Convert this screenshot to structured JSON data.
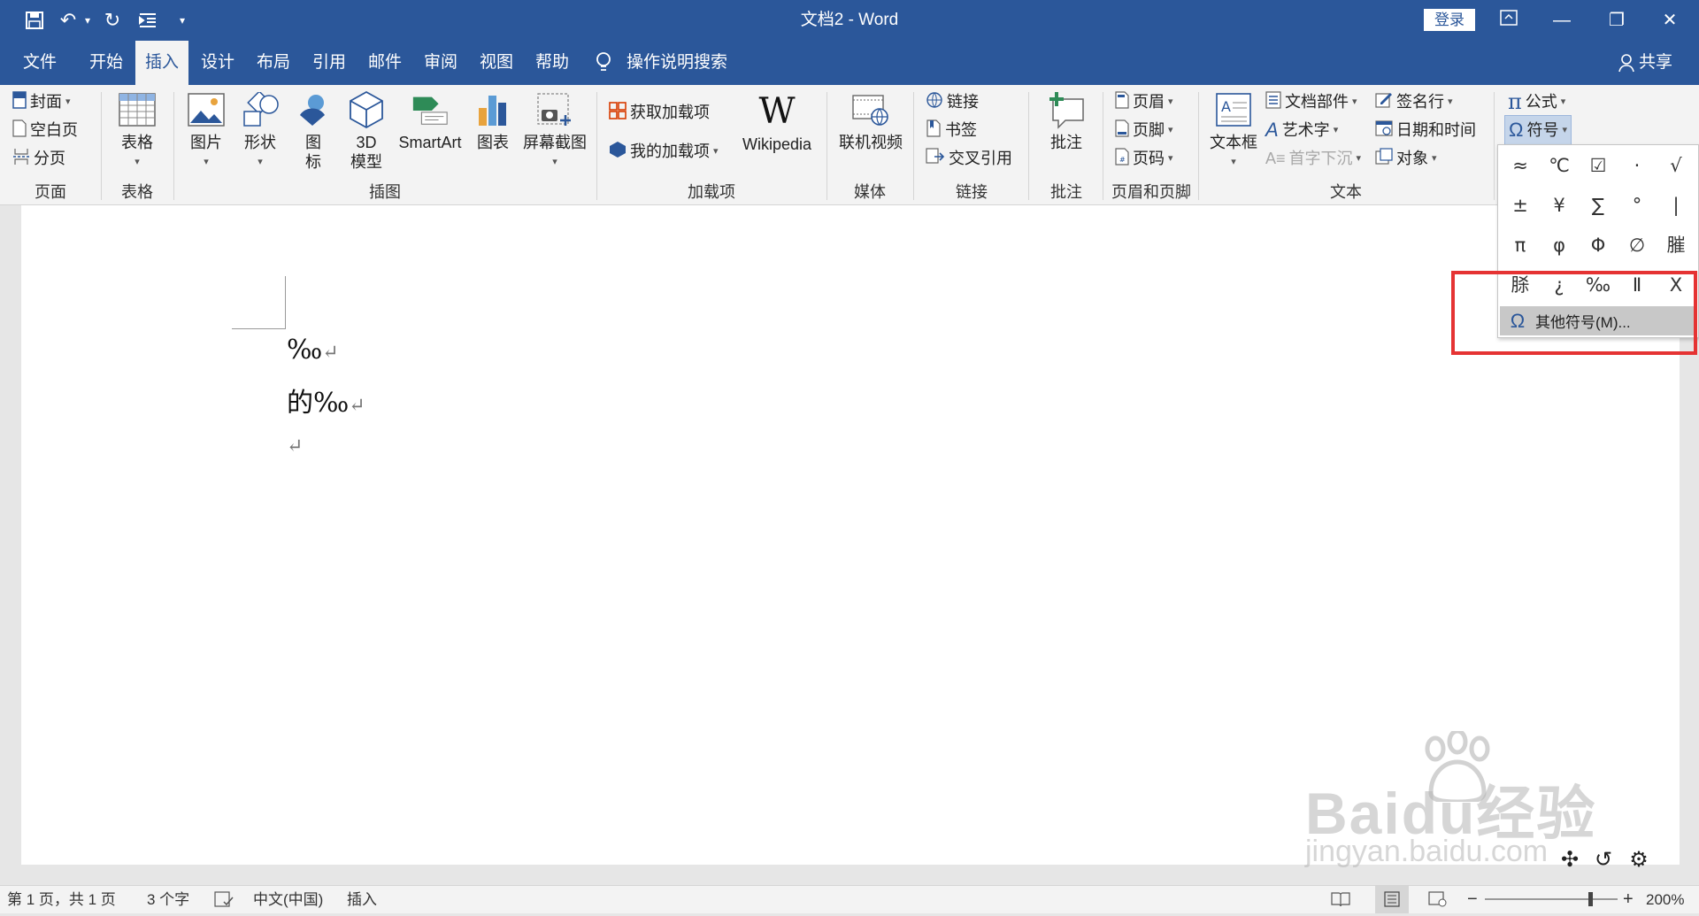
{
  "window": {
    "title": "文档2  -  Word",
    "login_label": "登录"
  },
  "quick_access": {
    "icons": [
      "save-icon",
      "undo-icon",
      "undo-dropdown-icon",
      "redo-icon",
      "outline-icon",
      "customize-qat-icon"
    ]
  },
  "tabs": [
    {
      "label": "文件"
    },
    {
      "label": "开始"
    },
    {
      "label": "插入"
    },
    {
      "label": "设计"
    },
    {
      "label": "布局"
    },
    {
      "label": "引用"
    },
    {
      "label": "邮件"
    },
    {
      "label": "审阅"
    },
    {
      "label": "视图"
    },
    {
      "label": "帮助"
    }
  ],
  "tell_me": "操作说明搜索",
  "share": "共享",
  "ribbon": {
    "pages": {
      "cover": "封面",
      "blank": "空白页",
      "break": "分页",
      "group": "页面"
    },
    "tables": {
      "table": "表格",
      "group": "表格"
    },
    "illustrations": {
      "picture": "图片",
      "shapes": "形状",
      "icons_1": "图",
      "icons_2": "标",
      "model_1": "3D",
      "model_2": "模型",
      "smartart": "SmartArt",
      "chart": "图表",
      "screenshot": "屏幕截图",
      "group": "插图"
    },
    "addins": {
      "get": "获取加载项",
      "my": "我的加载项",
      "wikipedia": "Wikipedia",
      "group": "加载项"
    },
    "media": {
      "video": "联机视频",
      "group": "媒体"
    },
    "links": {
      "link": "链接",
      "bookmark": "书签",
      "crossref": "交叉引用",
      "group": "链接"
    },
    "comments": {
      "comment": "批注",
      "group": "批注"
    },
    "header_footer": {
      "header": "页眉",
      "footer": "页脚",
      "pagenum": "页码",
      "group": "页眉和页脚"
    },
    "text": {
      "textbox": "文本框",
      "quickparts": "文档部件",
      "wordart": "艺术字",
      "dropcap": "首字下沉",
      "signature": "签名行",
      "datetime": "日期和时间",
      "object": "对象",
      "group": "文本"
    },
    "symbols": {
      "equation": "公式",
      "symbol": "符号"
    }
  },
  "symbol_dropdown": {
    "symbols": [
      "≈",
      "℃",
      "☑",
      "·",
      "√",
      "±",
      "¥",
      "∑",
      "°",
      "|",
      "π",
      "φ",
      "Φ",
      "∅",
      "膗",
      "脎",
      "¿",
      "‰",
      "Ⅱ",
      "X"
    ],
    "more_label": "其他符号(M)..."
  },
  "document": {
    "lines": [
      "‰",
      "的‰",
      ""
    ]
  },
  "watermark": {
    "brand": "Baidu经验",
    "url": "jingyan.baidu.com"
  },
  "status": {
    "page": "第 1 页，共 1 页",
    "words": "3 个字",
    "language": "中文(中国)",
    "mode": "插入",
    "zoom": "200%",
    "zoom_level": 0.78
  }
}
